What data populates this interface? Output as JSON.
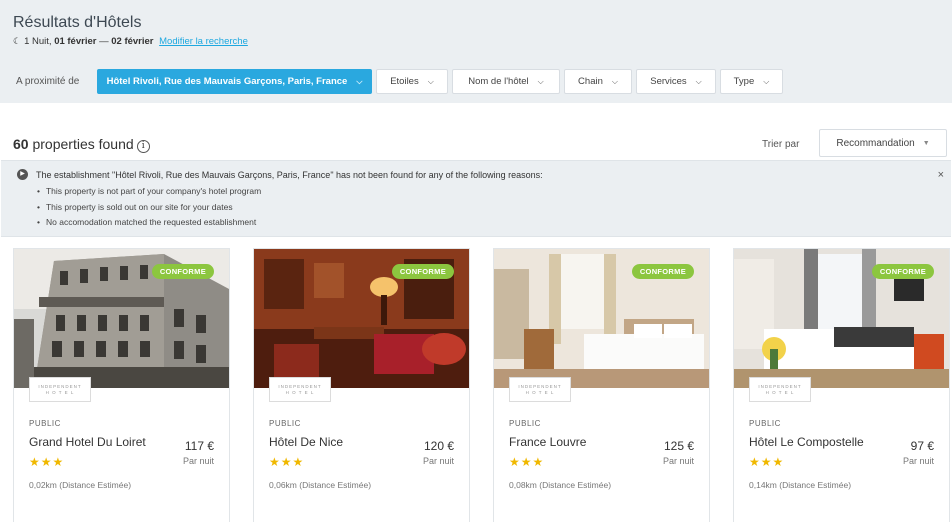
{
  "header": {
    "title": "Résultats d'Hôtels",
    "moon_icon": "moon-icon",
    "nights": "1 Nuit,",
    "date_from": "01 février",
    "date_sep": "—",
    "date_to": "02 février",
    "modify_link": "Modifier la recherche"
  },
  "filters": {
    "label": "A proximité de",
    "location": "Hôtel Rivoli, Rue des Mauvais Garçons, Paris, France",
    "stars": "Etoiles",
    "hotel_name": "Nom de l'hôtel",
    "chain": "Chain",
    "services": "Services",
    "type": "Type"
  },
  "results": {
    "count": "60",
    "count_label": "properties found",
    "info_icon": "ⓘ",
    "sort_label": "Trier par",
    "sort_value": "Recommandation"
  },
  "notice": {
    "title": "The establishment \"Hôtel Rivoli, Rue des Mauvais Garçons, Paris, France\" has not been found for any of the following reasons:",
    "reasons": [
      "This property is not part of your company's hotel program",
      "This property is sold out on our site for your dates",
      "No accomodation matched the requested establishment"
    ],
    "close": "×"
  },
  "hotels": [
    {
      "badge": "CONFORME",
      "logo_line1": "INDEPENDENT",
      "logo_line2": "H O T E L",
      "category": "PUBLIC",
      "name": "Grand Hotel Du Loiret",
      "stars": "★★★",
      "price": "117 €",
      "per_night": "Par nuit",
      "distance": "0,02km (Distance Estimée)"
    },
    {
      "badge": "CONFORME",
      "logo_line1": "INDEPENDENT",
      "logo_line2": "H O T E L",
      "category": "PUBLIC",
      "name": "Hôtel De Nice",
      "stars": "★★★",
      "price": "120 €",
      "per_night": "Par nuit",
      "distance": "0,06km (Distance Estimée)"
    },
    {
      "badge": "CONFORME",
      "logo_line1": "INDEPENDENT",
      "logo_line2": "H O T E L",
      "category": "PUBLIC",
      "name": "France Louvre",
      "stars": "★★★",
      "price": "125 €",
      "per_night": "Par nuit",
      "distance": "0,08km (Distance Estimée)"
    },
    {
      "badge": "CONFORME",
      "logo_line1": "INDEPENDENT",
      "logo_line2": "H O T E L",
      "category": "PUBLIC",
      "name": "Hôtel Le Compostelle",
      "stars": "★★★",
      "price": "97 €",
      "per_night": "Par nuit",
      "distance": "0,14km (Distance Estimée)"
    }
  ],
  "colors": {
    "accent": "#2aa8df",
    "badge": "#8cc63f",
    "stars": "#f0b800",
    "panel": "#ebeff2"
  }
}
